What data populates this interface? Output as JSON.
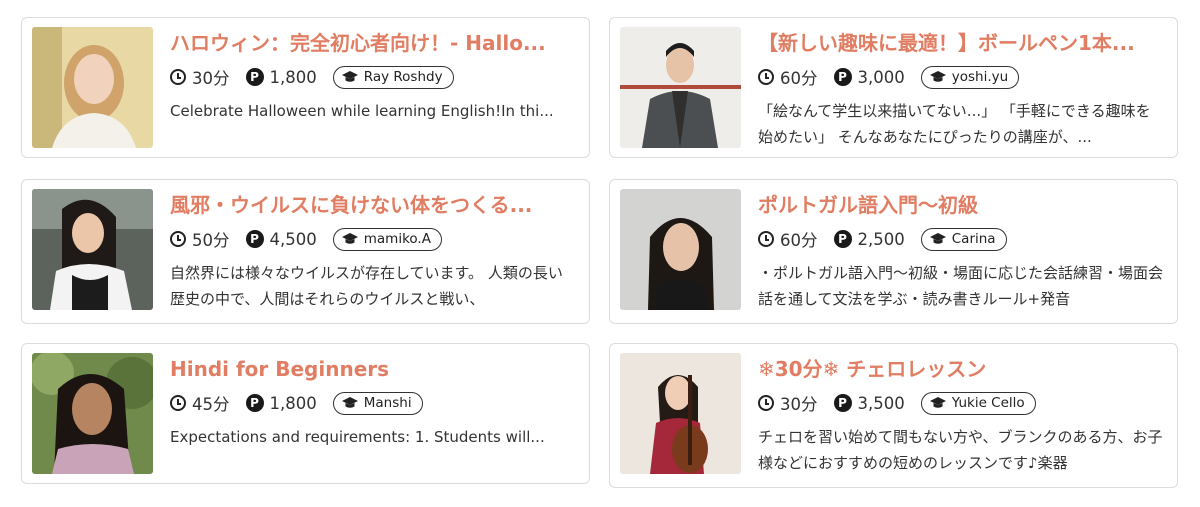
{
  "courses": [
    {
      "title": "ハロウィン：完全初心者向け！- Hallo...",
      "duration": "30分",
      "points": "1,800",
      "tutor": "Ray Roshdy",
      "description": "Celebrate Halloween while learning English!In thi...",
      "photo": "photo of a smiling woman with blond hair in a white sweater"
    },
    {
      "title": "【新しい趣味に最適！】ボールペン1本...",
      "duration": "60分",
      "points": "3,000",
      "tutor": "yoshi.yu",
      "description": "「絵なんて学生以来描いてない...」 「手軽にできる趣味を始めたい」 そんなあなたにぴったりの講座が、...",
      "photo": "photo of a man in a grey jacket against a white wall"
    },
    {
      "title": "風邪・ウイルスに負けない体をつくる...",
      "duration": "50分",
      "points": "4,500",
      "tutor": "mamiko.A",
      "description": "自然界には様々なウイルスが存在しています。 人類の長い歴史の中で、人間はそれらのウイルスと戦い、",
      "photo": "photo of a smiling woman in a white shirt and dark apron"
    },
    {
      "title": "ポルトガル語入門〜初級",
      "duration": "60分",
      "points": "2,500",
      "tutor": "Carina",
      "description": "・ポルトガル語入門〜初級・場面に応じた会話練習・場面会話を通して文法を学ぶ・読み書きルール+発音",
      "photo": "photo of a woman with long dark hair against a grey wall"
    },
    {
      "title": "Hindi for Beginners",
      "duration": "45分",
      "points": "1,800",
      "tutor": "Manshi",
      "description": "Expectations and requirements:   1. Students will...",
      "photo": "photo of a smiling woman with long dark hair outdoors"
    },
    {
      "title": "❄30分❄ チェロレッスン",
      "duration": "30分",
      "points": "3,500",
      "tutor": "Yukie Cello",
      "description": "チェロを習い始めて間もない方や、ブランクのある方、お子様などにおすすめの短めのレッスンです♪楽器",
      "photo": "photo of a woman in a red dress holding a cello"
    }
  ],
  "point_symbol": "P",
  "colors": {
    "title": "#e07d62",
    "border": "#dcdcdc",
    "text": "#333333"
  },
  "icons": {
    "duration": "clock-icon",
    "price": "points-icon",
    "tutor": "graduation-cap-icon"
  }
}
